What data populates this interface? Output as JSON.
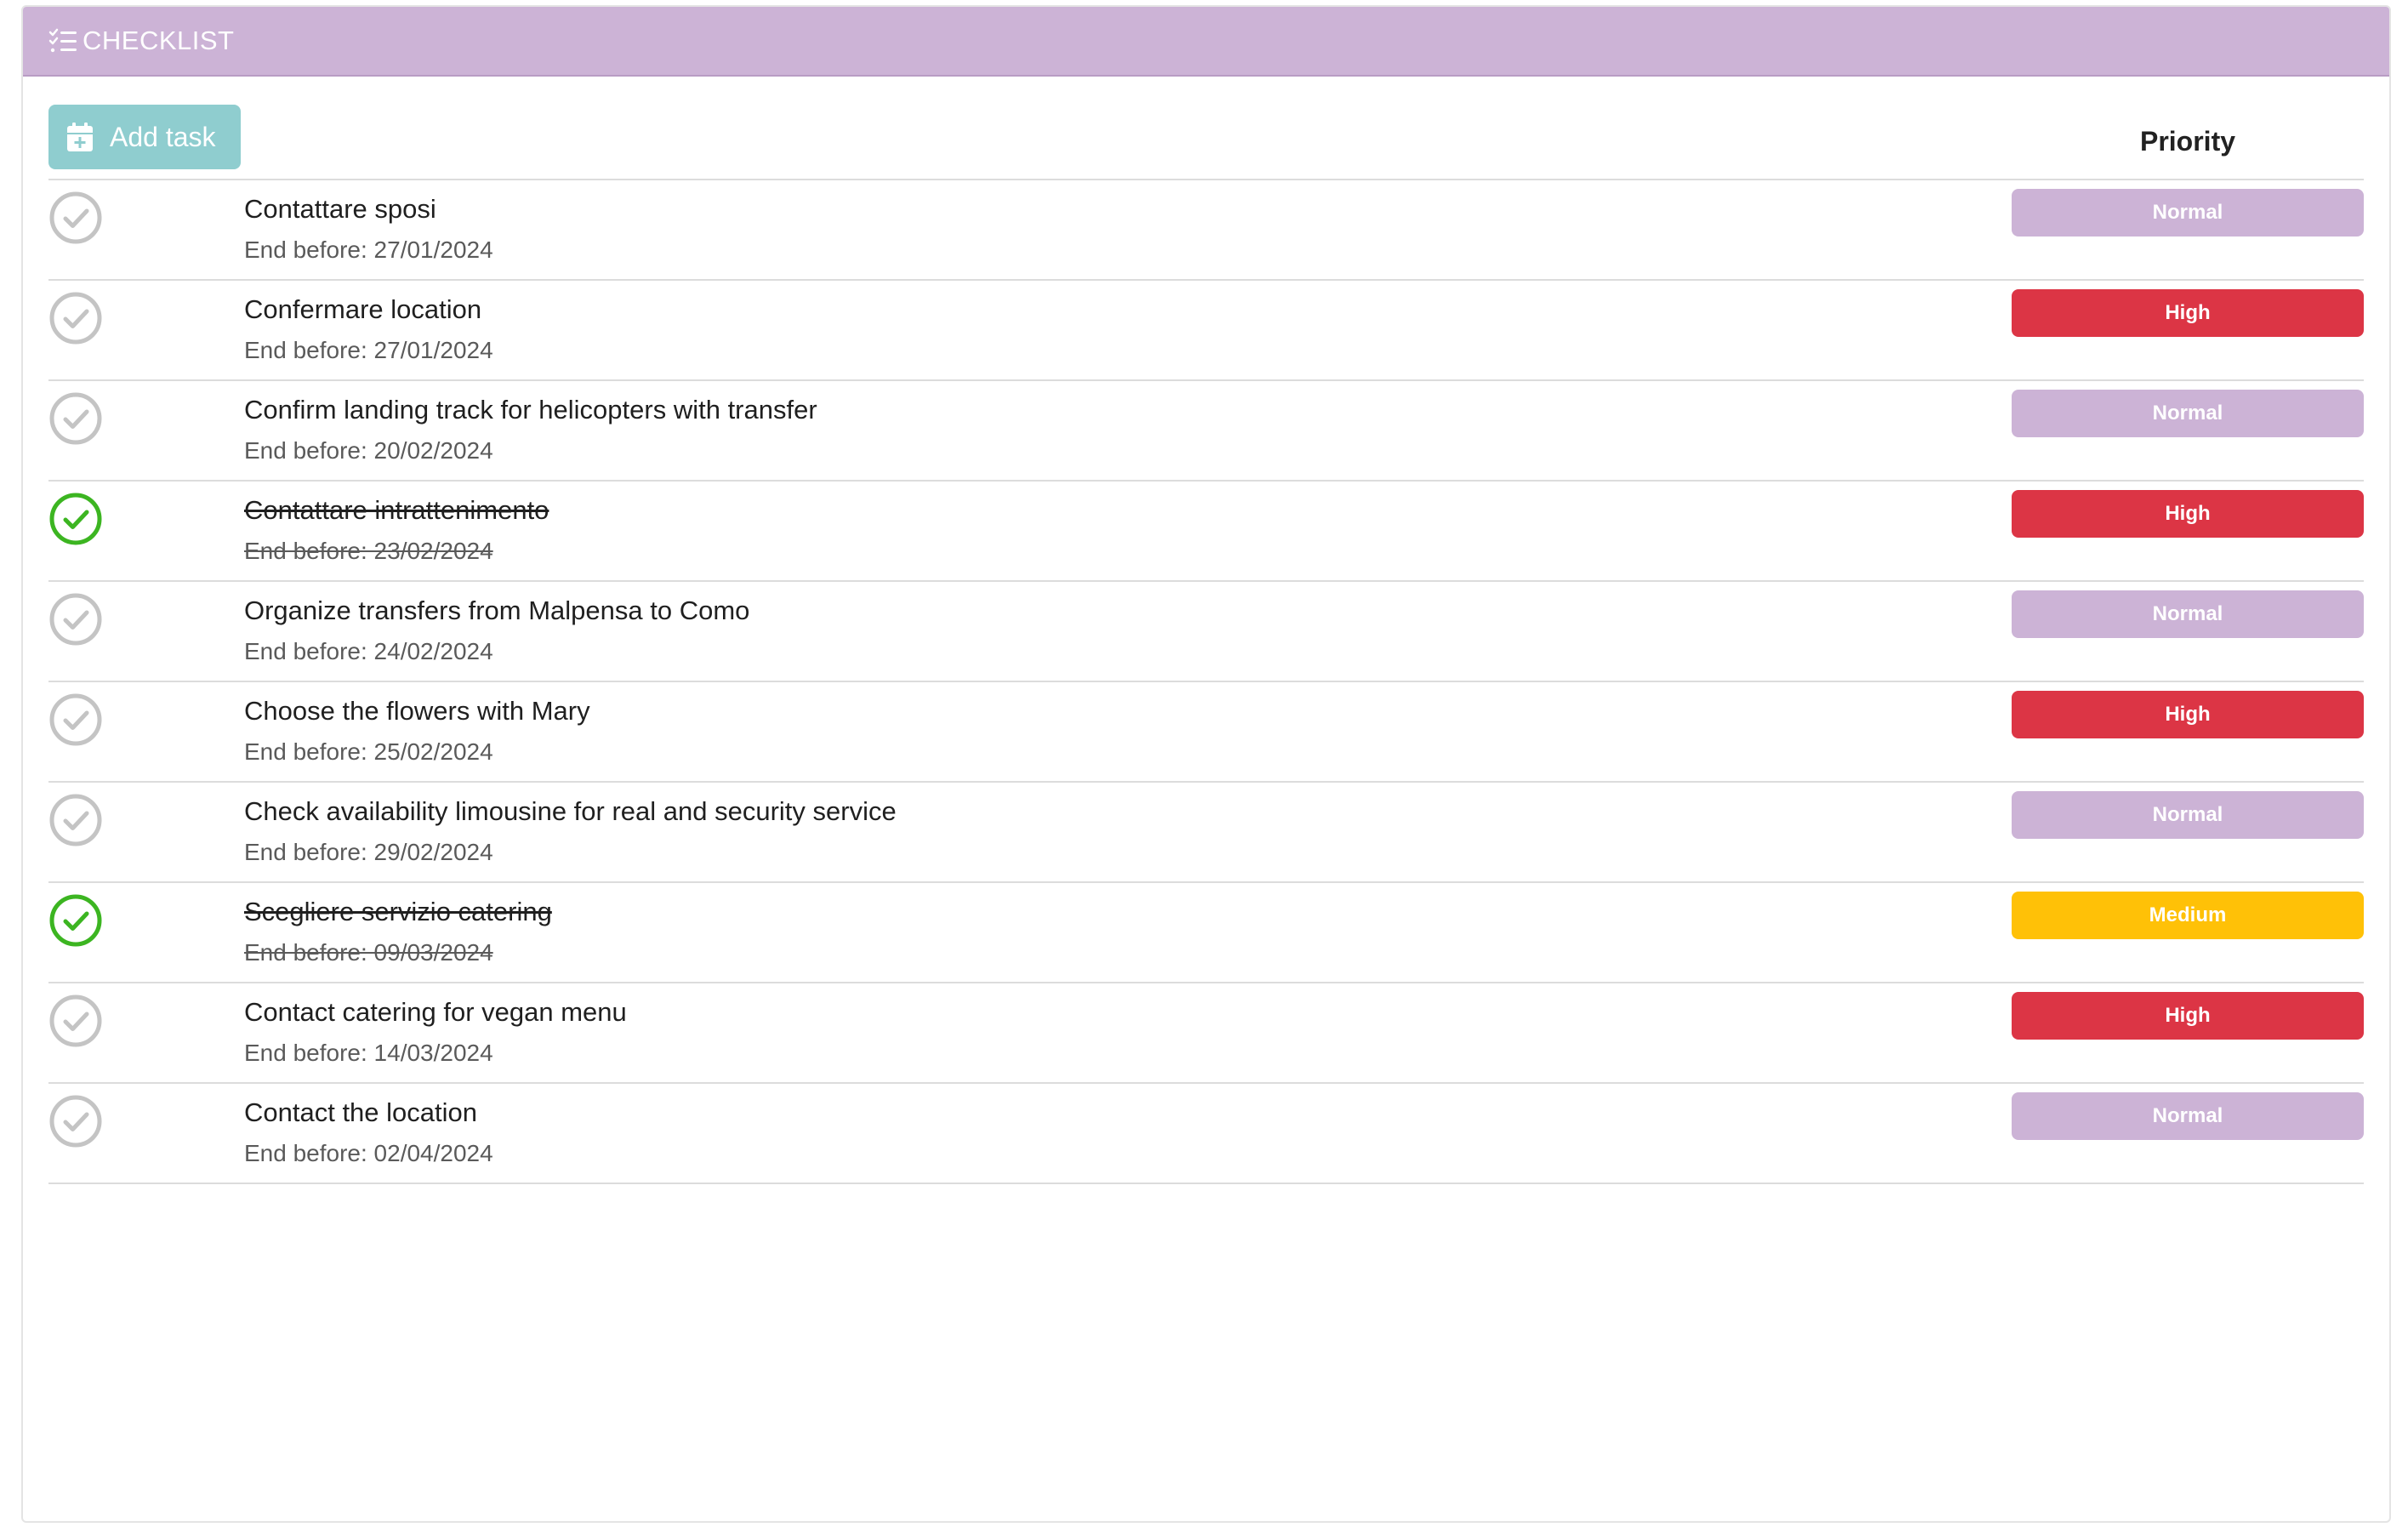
{
  "header": {
    "title": "CHECKLIST",
    "icon": "list-check-icon"
  },
  "toolbar": {
    "add_label": "Add task",
    "add_icon": "calendar-plus-icon",
    "priority_label": "Priority"
  },
  "colors": {
    "header_bg": "#ccb3d6",
    "add_button_bg": "#8fcdcf",
    "normal": "#ccb3d6",
    "high": "#dc3545",
    "medium": "#ffc107",
    "check_done": "#3cb521",
    "check_pending": "#c4c4c4"
  },
  "tasks": [
    {
      "title": "Contattare sposi",
      "due": "End before: 27/01/2024",
      "priority": "Normal",
      "done": false
    },
    {
      "title": "Confermare location",
      "due": "End before: 27/01/2024",
      "priority": "High",
      "done": false
    },
    {
      "title": "Confirm landing track for helicopters with transfer",
      "due": "End before: 20/02/2024",
      "priority": "Normal",
      "done": false
    },
    {
      "title": "Contattare intrattenimento",
      "due": "End before: 23/02/2024",
      "priority": "High",
      "done": true
    },
    {
      "title": "Organize transfers from Malpensa to Como",
      "due": "End before: 24/02/2024",
      "priority": "Normal",
      "done": false
    },
    {
      "title": "Choose the flowers with Mary",
      "due": "End before: 25/02/2024",
      "priority": "High",
      "done": false
    },
    {
      "title": "Check availability limousine for real and security service",
      "due": "End before: 29/02/2024",
      "priority": "Normal",
      "done": false
    },
    {
      "title": "Scegliere servizio catering",
      "due": "End before: 09/03/2024",
      "priority": "Medium",
      "done": true
    },
    {
      "title": "Contact catering for vegan menu",
      "due": "End before: 14/03/2024",
      "priority": "High",
      "done": false
    },
    {
      "title": "Contact the location",
      "due": "End before: 02/04/2024",
      "priority": "Normal",
      "done": false
    }
  ]
}
